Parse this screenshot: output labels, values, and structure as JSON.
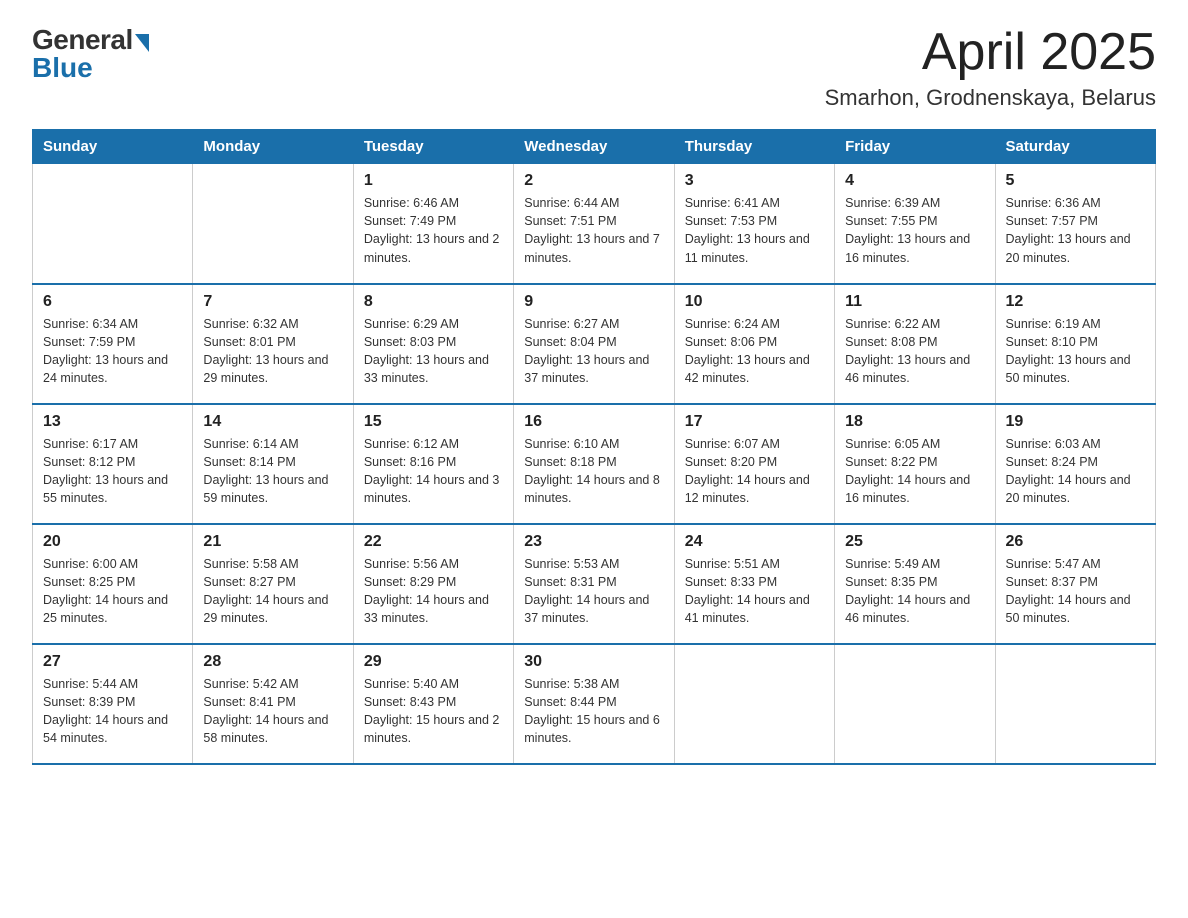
{
  "header": {
    "logo_general": "General",
    "logo_blue": "Blue",
    "month": "April 2025",
    "location": "Smarhon, Grodnenskaya, Belarus"
  },
  "weekdays": [
    "Sunday",
    "Monday",
    "Tuesday",
    "Wednesday",
    "Thursday",
    "Friday",
    "Saturday"
  ],
  "weeks": [
    [
      {
        "day": "",
        "sunrise": "",
        "sunset": "",
        "daylight": ""
      },
      {
        "day": "",
        "sunrise": "",
        "sunset": "",
        "daylight": ""
      },
      {
        "day": "1",
        "sunrise": "Sunrise: 6:46 AM",
        "sunset": "Sunset: 7:49 PM",
        "daylight": "Daylight: 13 hours and 2 minutes."
      },
      {
        "day": "2",
        "sunrise": "Sunrise: 6:44 AM",
        "sunset": "Sunset: 7:51 PM",
        "daylight": "Daylight: 13 hours and 7 minutes."
      },
      {
        "day": "3",
        "sunrise": "Sunrise: 6:41 AM",
        "sunset": "Sunset: 7:53 PM",
        "daylight": "Daylight: 13 hours and 11 minutes."
      },
      {
        "day": "4",
        "sunrise": "Sunrise: 6:39 AM",
        "sunset": "Sunset: 7:55 PM",
        "daylight": "Daylight: 13 hours and 16 minutes."
      },
      {
        "day": "5",
        "sunrise": "Sunrise: 6:36 AM",
        "sunset": "Sunset: 7:57 PM",
        "daylight": "Daylight: 13 hours and 20 minutes."
      }
    ],
    [
      {
        "day": "6",
        "sunrise": "Sunrise: 6:34 AM",
        "sunset": "Sunset: 7:59 PM",
        "daylight": "Daylight: 13 hours and 24 minutes."
      },
      {
        "day": "7",
        "sunrise": "Sunrise: 6:32 AM",
        "sunset": "Sunset: 8:01 PM",
        "daylight": "Daylight: 13 hours and 29 minutes."
      },
      {
        "day": "8",
        "sunrise": "Sunrise: 6:29 AM",
        "sunset": "Sunset: 8:03 PM",
        "daylight": "Daylight: 13 hours and 33 minutes."
      },
      {
        "day": "9",
        "sunrise": "Sunrise: 6:27 AM",
        "sunset": "Sunset: 8:04 PM",
        "daylight": "Daylight: 13 hours and 37 minutes."
      },
      {
        "day": "10",
        "sunrise": "Sunrise: 6:24 AM",
        "sunset": "Sunset: 8:06 PM",
        "daylight": "Daylight: 13 hours and 42 minutes."
      },
      {
        "day": "11",
        "sunrise": "Sunrise: 6:22 AM",
        "sunset": "Sunset: 8:08 PM",
        "daylight": "Daylight: 13 hours and 46 minutes."
      },
      {
        "day": "12",
        "sunrise": "Sunrise: 6:19 AM",
        "sunset": "Sunset: 8:10 PM",
        "daylight": "Daylight: 13 hours and 50 minutes."
      }
    ],
    [
      {
        "day": "13",
        "sunrise": "Sunrise: 6:17 AM",
        "sunset": "Sunset: 8:12 PM",
        "daylight": "Daylight: 13 hours and 55 minutes."
      },
      {
        "day": "14",
        "sunrise": "Sunrise: 6:14 AM",
        "sunset": "Sunset: 8:14 PM",
        "daylight": "Daylight: 13 hours and 59 minutes."
      },
      {
        "day": "15",
        "sunrise": "Sunrise: 6:12 AM",
        "sunset": "Sunset: 8:16 PM",
        "daylight": "Daylight: 14 hours and 3 minutes."
      },
      {
        "day": "16",
        "sunrise": "Sunrise: 6:10 AM",
        "sunset": "Sunset: 8:18 PM",
        "daylight": "Daylight: 14 hours and 8 minutes."
      },
      {
        "day": "17",
        "sunrise": "Sunrise: 6:07 AM",
        "sunset": "Sunset: 8:20 PM",
        "daylight": "Daylight: 14 hours and 12 minutes."
      },
      {
        "day": "18",
        "sunrise": "Sunrise: 6:05 AM",
        "sunset": "Sunset: 8:22 PM",
        "daylight": "Daylight: 14 hours and 16 minutes."
      },
      {
        "day": "19",
        "sunrise": "Sunrise: 6:03 AM",
        "sunset": "Sunset: 8:24 PM",
        "daylight": "Daylight: 14 hours and 20 minutes."
      }
    ],
    [
      {
        "day": "20",
        "sunrise": "Sunrise: 6:00 AM",
        "sunset": "Sunset: 8:25 PM",
        "daylight": "Daylight: 14 hours and 25 minutes."
      },
      {
        "day": "21",
        "sunrise": "Sunrise: 5:58 AM",
        "sunset": "Sunset: 8:27 PM",
        "daylight": "Daylight: 14 hours and 29 minutes."
      },
      {
        "day": "22",
        "sunrise": "Sunrise: 5:56 AM",
        "sunset": "Sunset: 8:29 PM",
        "daylight": "Daylight: 14 hours and 33 minutes."
      },
      {
        "day": "23",
        "sunrise": "Sunrise: 5:53 AM",
        "sunset": "Sunset: 8:31 PM",
        "daylight": "Daylight: 14 hours and 37 minutes."
      },
      {
        "day": "24",
        "sunrise": "Sunrise: 5:51 AM",
        "sunset": "Sunset: 8:33 PM",
        "daylight": "Daylight: 14 hours and 41 minutes."
      },
      {
        "day": "25",
        "sunrise": "Sunrise: 5:49 AM",
        "sunset": "Sunset: 8:35 PM",
        "daylight": "Daylight: 14 hours and 46 minutes."
      },
      {
        "day": "26",
        "sunrise": "Sunrise: 5:47 AM",
        "sunset": "Sunset: 8:37 PM",
        "daylight": "Daylight: 14 hours and 50 minutes."
      }
    ],
    [
      {
        "day": "27",
        "sunrise": "Sunrise: 5:44 AM",
        "sunset": "Sunset: 8:39 PM",
        "daylight": "Daylight: 14 hours and 54 minutes."
      },
      {
        "day": "28",
        "sunrise": "Sunrise: 5:42 AM",
        "sunset": "Sunset: 8:41 PM",
        "daylight": "Daylight: 14 hours and 58 minutes."
      },
      {
        "day": "29",
        "sunrise": "Sunrise: 5:40 AM",
        "sunset": "Sunset: 8:43 PM",
        "daylight": "Daylight: 15 hours and 2 minutes."
      },
      {
        "day": "30",
        "sunrise": "Sunrise: 5:38 AM",
        "sunset": "Sunset: 8:44 PM",
        "daylight": "Daylight: 15 hours and 6 minutes."
      },
      {
        "day": "",
        "sunrise": "",
        "sunset": "",
        "daylight": ""
      },
      {
        "day": "",
        "sunrise": "",
        "sunset": "",
        "daylight": ""
      },
      {
        "day": "",
        "sunrise": "",
        "sunset": "",
        "daylight": ""
      }
    ]
  ]
}
